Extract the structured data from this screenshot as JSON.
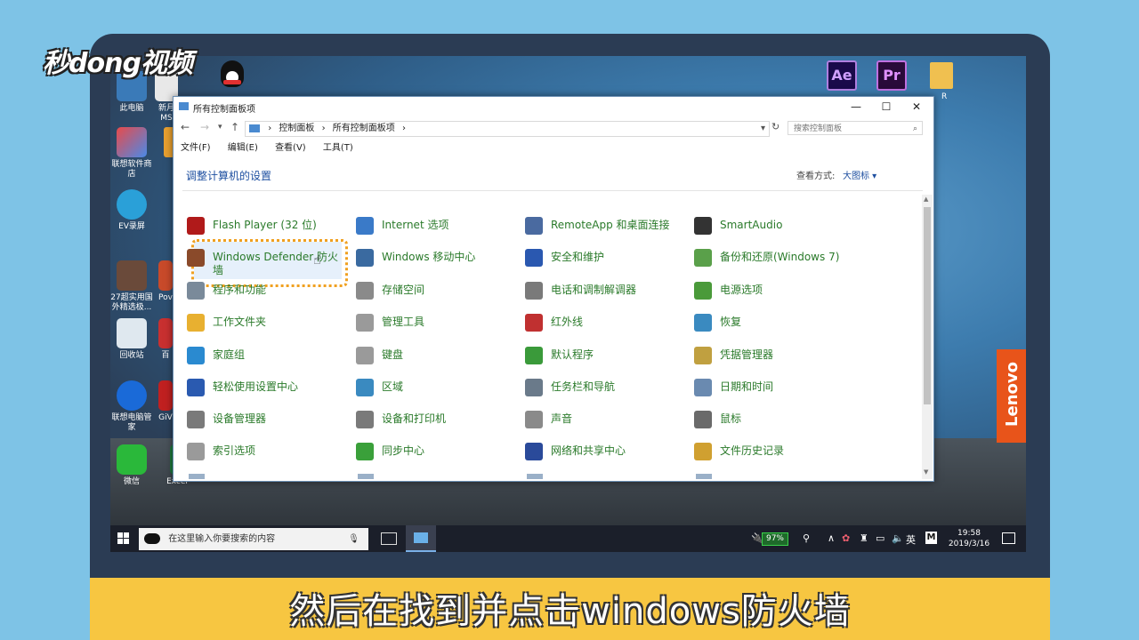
{
  "branding": {
    "logo": "秒dong视频",
    "lenovo": "Lenovo"
  },
  "subtitle": "然后在找到并点击windows防火墙",
  "desktop": {
    "shortcuts": [
      {
        "label": "此电脑"
      },
      {
        "label": "新月\nMS"
      },
      {
        "label": "联想软件商\n店"
      },
      {
        "label": "EV录屏"
      },
      {
        "label": "27超实用国\n外精选极..."
      },
      {
        "label": "回收站"
      },
      {
        "label": "联想电脑管\n家"
      },
      {
        "label": "微信"
      },
      {
        "label": "Excel"
      },
      {
        "label": "Pov"
      },
      {
        "label": "GiV"
      },
      {
        "label": "百"
      }
    ],
    "top_right": [
      {
        "label": "Ae"
      },
      {
        "label": "Pr"
      },
      {
        "label": "R"
      }
    ]
  },
  "window": {
    "title": "所有控制面板项",
    "breadcrumb": [
      "控制面板",
      "所有控制面板项"
    ],
    "search_placeholder": "搜索控制面板",
    "menu": [
      "文件(F)",
      "编辑(E)",
      "查看(V)",
      "工具(T)"
    ],
    "heading": "调整计算机的设置",
    "view_by_label": "查看方式:",
    "view_by_value": "大图标 ▾",
    "controls": {
      "minimize": "—",
      "maximize": "☐",
      "close": "✕"
    }
  },
  "items": [
    {
      "label": "Flash Player (32 位)",
      "color": "#b01a1a"
    },
    {
      "label": "Internet 选项",
      "color": "#3a7ac8"
    },
    {
      "label": "RemoteApp 和桌面连接",
      "color": "#4a6aa0"
    },
    {
      "label": "SmartAudio",
      "color": "#333333"
    },
    {
      "label": "Windows Defender 防火墙",
      "color": "#8a4a2a"
    },
    {
      "label": "Windows 移动中心",
      "color": "#3a6aa0"
    },
    {
      "label": "安全和维护",
      "color": "#2a58b0"
    },
    {
      "label": "备份和还原(Windows 7)",
      "color": "#5aa04a"
    },
    {
      "label": "程序和功能",
      "color": "#7a8a9a"
    },
    {
      "label": "存储空间",
      "color": "#8a8a8a"
    },
    {
      "label": "电话和调制解调器",
      "color": "#7a7a7a"
    },
    {
      "label": "电源选项",
      "color": "#4a9a3a"
    },
    {
      "label": "工作文件夹",
      "color": "#e8b030"
    },
    {
      "label": "管理工具",
      "color": "#9a9a9a"
    },
    {
      "label": "红外线",
      "color": "#c03030"
    },
    {
      "label": "恢复",
      "color": "#3a8ac0"
    },
    {
      "label": "家庭组",
      "color": "#2a8ad0"
    },
    {
      "label": "键盘",
      "color": "#9a9a9a"
    },
    {
      "label": "默认程序",
      "color": "#3a9a3a"
    },
    {
      "label": "凭据管理器",
      "color": "#c0a040"
    },
    {
      "label": "轻松使用设置中心",
      "color": "#2a5ab0"
    },
    {
      "label": "区域",
      "color": "#3a8ac0"
    },
    {
      "label": "任务栏和导航",
      "color": "#6a7a8a"
    },
    {
      "label": "日期和时间",
      "color": "#6a8ab0"
    },
    {
      "label": "设备管理器",
      "color": "#7a7a7a"
    },
    {
      "label": "设备和打印机",
      "color": "#7a7a7a"
    },
    {
      "label": "声音",
      "color": "#8a8a8a"
    },
    {
      "label": "鼠标",
      "color": "#6a6a6a"
    },
    {
      "label": "索引选项",
      "color": "#9a9a9a"
    },
    {
      "label": "同步中心",
      "color": "#3aa03a"
    },
    {
      "label": "网络和共享中心",
      "color": "#2a4a9a"
    },
    {
      "label": "文件历史记录",
      "color": "#d0a030"
    }
  ],
  "taskbar": {
    "search_placeholder": "在这里输入你要搜索的内容",
    "battery": "97%",
    "ime": "英",
    "time": "19:58",
    "date": "2019/3/16"
  }
}
